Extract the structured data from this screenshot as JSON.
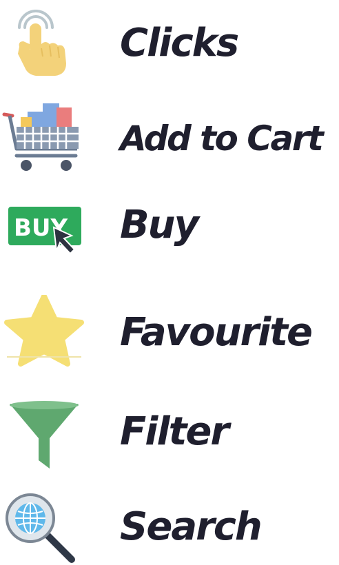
{
  "items": [
    {
      "label": "Clicks",
      "icon": "pointing-hand-click-icon"
    },
    {
      "label": "Add to Cart",
      "icon": "shopping-cart-icon"
    },
    {
      "label": "Buy",
      "icon": "buy-button-icon"
    },
    {
      "label": "Favourite",
      "icon": "star-icon"
    },
    {
      "label": "Filter",
      "icon": "funnel-icon"
    },
    {
      "label": "Search",
      "icon": "globe-magnifier-icon"
    }
  ],
  "colors": {
    "text": "#1f1f2e",
    "hand": "#f3d27a",
    "cart_body": "#6b7c93",
    "buy_green": "#2eaa5c",
    "star": "#f5df74",
    "funnel": "#5fa86f",
    "search_globe": "#5fb8ea"
  }
}
